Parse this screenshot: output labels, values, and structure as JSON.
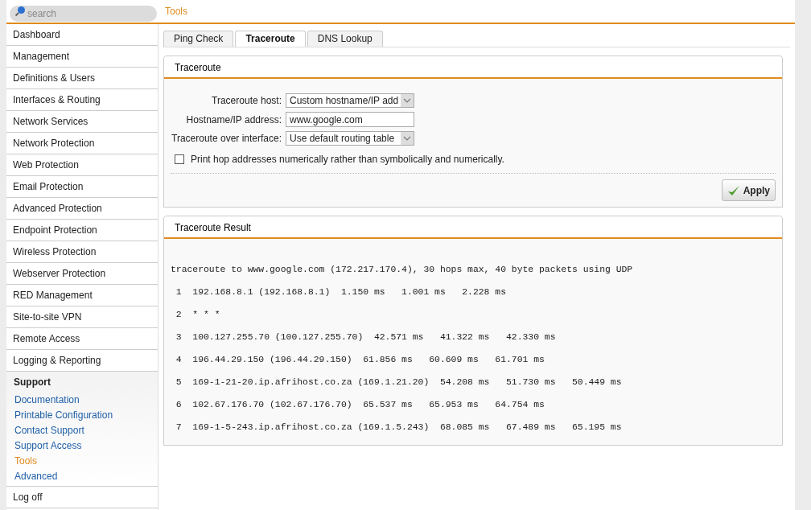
{
  "search": {
    "placeholder": "search"
  },
  "breadcrumb": "Tools",
  "sidebar": {
    "items": [
      {
        "kind": "item",
        "label": "Dashboard"
      },
      {
        "kind": "item",
        "label": "Management"
      },
      {
        "kind": "item",
        "label": "Definitions & Users"
      },
      {
        "kind": "item",
        "label": "Interfaces & Routing"
      },
      {
        "kind": "item",
        "label": "Network Services"
      },
      {
        "kind": "item",
        "label": "Network Protection"
      },
      {
        "kind": "item",
        "label": "Web Protection"
      },
      {
        "kind": "item",
        "label": "Email Protection"
      },
      {
        "kind": "item",
        "label": "Advanced Protection"
      },
      {
        "kind": "item",
        "label": "Endpoint Protection"
      },
      {
        "kind": "item",
        "label": "Wireless Protection"
      },
      {
        "kind": "item",
        "label": "Webserver Protection"
      },
      {
        "kind": "item",
        "label": "RED Management"
      },
      {
        "kind": "item",
        "label": "Site-to-site VPN"
      },
      {
        "kind": "item",
        "label": "Remote Access"
      },
      {
        "kind": "item",
        "label": "Logging & Reporting"
      },
      {
        "kind": "section",
        "label": "Support",
        "children": [
          {
            "label": "Documentation",
            "selected": false
          },
          {
            "label": "Printable Configuration",
            "selected": false
          },
          {
            "label": "Contact Support",
            "selected": false
          },
          {
            "label": "Support Access",
            "selected": false
          },
          {
            "label": "Tools",
            "selected": true
          },
          {
            "label": "Advanced",
            "selected": false
          }
        ]
      },
      {
        "kind": "item",
        "label": "Log off"
      }
    ]
  },
  "tabs": [
    {
      "label": "Ping Check",
      "selected": false
    },
    {
      "label": "Traceroute",
      "selected": true
    },
    {
      "label": "DNS Lookup",
      "selected": false
    }
  ],
  "form_panel": {
    "title": "Traceroute",
    "fields": [
      {
        "kind": "select",
        "label": "Traceroute host:",
        "value": "Custom hostname/IP add"
      },
      {
        "kind": "input",
        "label": "Hostname/IP address:",
        "value": "www.google.com"
      },
      {
        "kind": "select",
        "label": "Traceroute over interface:",
        "value": "Use default routing table"
      }
    ],
    "checkbox": {
      "label": "Print hop addresses numerically rather than symbolically and numerically.",
      "checked": false
    },
    "apply_button": "Apply"
  },
  "result_panel": {
    "title": "Traceroute Result",
    "lines": [
      "traceroute to www.google.com (172.217.170.4), 30 hops max, 40 byte packets using UDP",
      " 1  192.168.8.1 (192.168.8.1)  1.150 ms   1.001 ms   2.228 ms",
      " 2  * * *",
      " 3  100.127.255.70 (100.127.255.70)  42.571 ms   41.322 ms   42.330 ms",
      " 4  196.44.29.150 (196.44.29.150)  61.856 ms   60.609 ms   61.701 ms",
      " 5  169-1-21-20.ip.afrihost.co.za (169.1.21.20)  54.208 ms   51.730 ms   50.449 ms",
      " 6  102.67.176.70 (102.67.176.70)  65.537 ms   65.953 ms   64.754 ms",
      " 7  169-1-5-243.ip.afrihost.co.za (169.1.5.243)  68.085 ms   67.489 ms   65.195 ms"
    ]
  }
}
